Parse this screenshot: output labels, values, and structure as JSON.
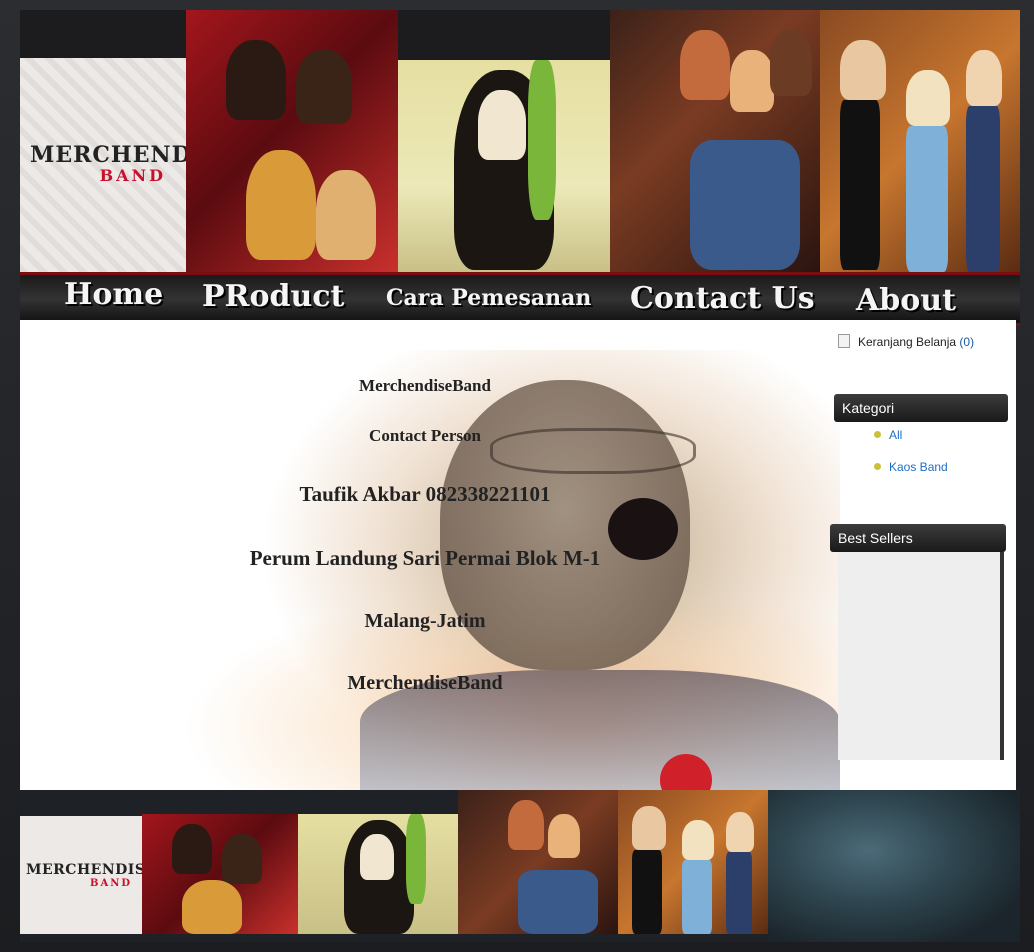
{
  "logo": {
    "main": "MERCHENDISE",
    "sub": "BAND"
  },
  "nav": {
    "items": [
      "Home",
      "PRoduct",
      "Cara Pemesanan",
      "Contact Us",
      "About"
    ]
  },
  "cart": {
    "label": "Keranjang Belanja",
    "count": "(0)"
  },
  "sidebar": {
    "kategori_title": "Kategori",
    "kategori_items": [
      "All",
      "Kaos Band"
    ],
    "best_sellers_title": "Best Sellers"
  },
  "contact": {
    "line1": "MerchendiseBand",
    "line2": "Contact Person",
    "line3": "Taufik Akbar 082338221101",
    "line4": "Perum Landung Sari Permai Blok M-1",
    "line5": "Malang-Jatim",
    "line6": "MerchendiseBand"
  },
  "footer": {
    "logo_main": "MERCHENDISE",
    "logo_sub": "BAND"
  },
  "colors": {
    "accent_red": "#c8102e",
    "link_blue": "#1e6fc4",
    "bullet": "#c9c236"
  }
}
